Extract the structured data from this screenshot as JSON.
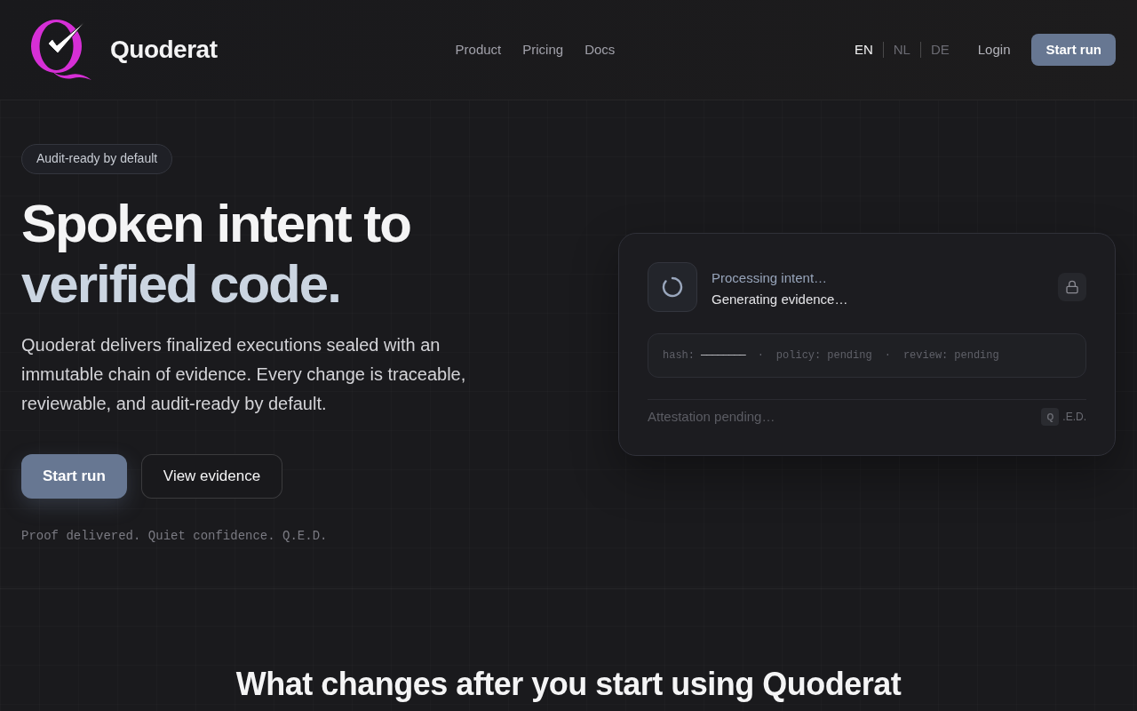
{
  "header": {
    "brand": "Quoderat",
    "nav": [
      "Product",
      "Pricing",
      "Docs"
    ],
    "languages": [
      {
        "label": "EN",
        "selected": true
      },
      {
        "label": "NL",
        "selected": false
      },
      {
        "label": "DE",
        "selected": false
      }
    ],
    "login": "Login",
    "cta": "Start run"
  },
  "hero": {
    "badge": "Audit-ready by default",
    "headline": {
      "lead": "Spoken intent to",
      "accent": "verified code."
    },
    "description": "Quoderat delivers finalized executions sealed with an immutable chain of evidence. Every change is traceable, reviewable, and audit-ready by default.",
    "buttons": [
      {
        "label": "Start run",
        "kind": "primary"
      },
      {
        "label": "View evidence",
        "kind": "secondary"
      }
    ],
    "tagline": "Proof delivered. Quiet confidence. Q.E.D."
  },
  "status_card": {
    "title": "Processing intent…",
    "subtitle": "Generating evidence…",
    "evidence": [
      {
        "label": "hash:",
        "value": "————————"
      },
      {
        "separator": "·",
        "label": "policy:",
        "value": "pending"
      },
      {
        "separator": "·",
        "label": "review:",
        "value": "pending"
      }
    ],
    "attestation": "Attestation pending…",
    "seal": {
      "mark": "Q",
      "text": ".E.D."
    }
  },
  "section": {
    "heading": "What changes after you start using Quoderat"
  }
}
